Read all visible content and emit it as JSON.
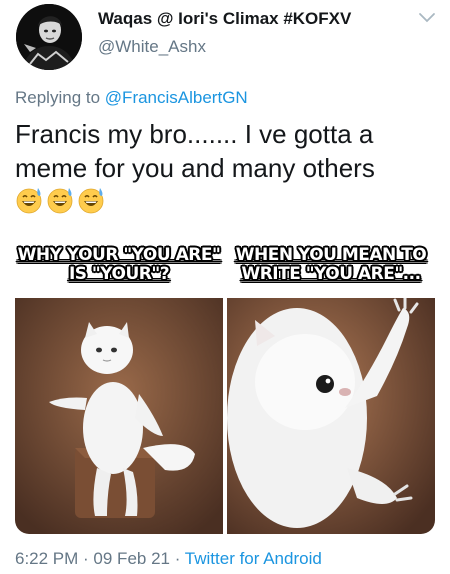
{
  "author": {
    "display_name": "Waqas @ Iori's Climax #KOFXV",
    "handle": "@White_Ashx",
    "avatar_icon": "avatar-profile-photo"
  },
  "reply": {
    "prefix": "Replying to",
    "mention": "@FrancisAlbertGN"
  },
  "tweet": {
    "text": "Francis my bro....... I ve gotta a meme for you and many others",
    "emojis": [
      "grinning-sweat-emoji",
      "grinning-sweat-emoji",
      "grinning-sweat-emoji"
    ]
  },
  "media": {
    "left_caption_line1": "WHY YOUR \"YOU ARE\"",
    "left_caption_line2": "IS \"YOUR\"?",
    "right_caption_line1": "WHEN YOU MEAN TO",
    "right_caption_line2": "WRITE \"YOU ARE\"..."
  },
  "footer": {
    "time": "6:22 PM",
    "separator1": " · ",
    "date": "09 Feb 21",
    "separator2": " · ",
    "source": "Twitter for Android"
  },
  "colors": {
    "link": "#1b95e0",
    "secondary": "#657786",
    "text": "#14171a"
  }
}
